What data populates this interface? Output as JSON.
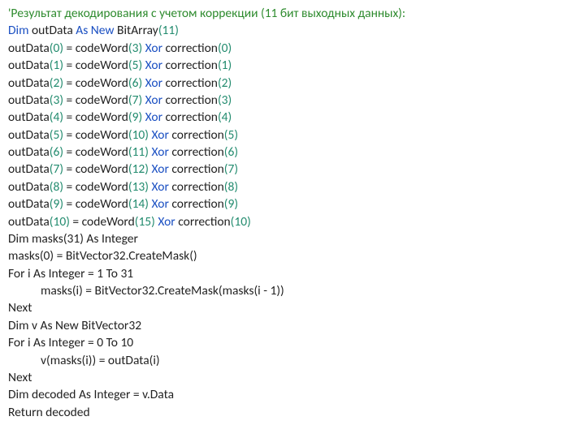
{
  "lines": [
    {
      "segs": [
        {
          "t": "'Результат декодирования с учетом коррекции (11 бит выходных данных):",
          "c": "cm"
        }
      ]
    },
    {
      "segs": [
        {
          "t": "Dim",
          "c": "kw"
        },
        {
          "t": " outData ",
          "c": "txt"
        },
        {
          "t": "As New",
          "c": "kw"
        },
        {
          "t": " BitArray",
          "c": "txt"
        },
        {
          "t": "(",
          "c": "pn"
        },
        {
          "t": "11",
          "c": "nm"
        },
        {
          "t": ")",
          "c": "pn"
        }
      ]
    },
    {
      "segs": [
        {
          "t": "outData",
          "c": "txt"
        },
        {
          "t": "(",
          "c": "pn"
        },
        {
          "t": "0",
          "c": "nm"
        },
        {
          "t": ")",
          "c": "pn"
        },
        {
          "t": " = codeWord",
          "c": "txt"
        },
        {
          "t": "(",
          "c": "pn"
        },
        {
          "t": "3",
          "c": "nm"
        },
        {
          "t": ")",
          "c": "pn"
        },
        {
          "t": " ",
          "c": "txt"
        },
        {
          "t": "Xor",
          "c": "kw"
        },
        {
          "t": " correction",
          "c": "txt"
        },
        {
          "t": "(",
          "c": "pn"
        },
        {
          "t": "0",
          "c": "nm"
        },
        {
          "t": ")",
          "c": "pn"
        }
      ]
    },
    {
      "segs": [
        {
          "t": "outData",
          "c": "txt"
        },
        {
          "t": "(",
          "c": "pn"
        },
        {
          "t": "1",
          "c": "nm"
        },
        {
          "t": ")",
          "c": "pn"
        },
        {
          "t": " = codeWord",
          "c": "txt"
        },
        {
          "t": "(",
          "c": "pn"
        },
        {
          "t": "5",
          "c": "nm"
        },
        {
          "t": ")",
          "c": "pn"
        },
        {
          "t": " ",
          "c": "txt"
        },
        {
          "t": "Xor",
          "c": "kw"
        },
        {
          "t": " correction",
          "c": "txt"
        },
        {
          "t": "(",
          "c": "pn"
        },
        {
          "t": "1",
          "c": "nm"
        },
        {
          "t": ")",
          "c": "pn"
        }
      ]
    },
    {
      "segs": [
        {
          "t": "outData",
          "c": "txt"
        },
        {
          "t": "(",
          "c": "pn"
        },
        {
          "t": "2",
          "c": "nm"
        },
        {
          "t": ")",
          "c": "pn"
        },
        {
          "t": " = codeWord",
          "c": "txt"
        },
        {
          "t": "(",
          "c": "pn"
        },
        {
          "t": "6",
          "c": "nm"
        },
        {
          "t": ")",
          "c": "pn"
        },
        {
          "t": " ",
          "c": "txt"
        },
        {
          "t": "Xor",
          "c": "kw"
        },
        {
          "t": " correction",
          "c": "txt"
        },
        {
          "t": "(",
          "c": "pn"
        },
        {
          "t": "2",
          "c": "nm"
        },
        {
          "t": ")",
          "c": "pn"
        }
      ]
    },
    {
      "segs": [
        {
          "t": "outData",
          "c": "txt"
        },
        {
          "t": "(",
          "c": "pn"
        },
        {
          "t": "3",
          "c": "nm"
        },
        {
          "t": ")",
          "c": "pn"
        },
        {
          "t": " = codeWord",
          "c": "txt"
        },
        {
          "t": "(",
          "c": "pn"
        },
        {
          "t": "7",
          "c": "nm"
        },
        {
          "t": ")",
          "c": "pn"
        },
        {
          "t": " ",
          "c": "txt"
        },
        {
          "t": "Xor",
          "c": "kw"
        },
        {
          "t": " correction",
          "c": "txt"
        },
        {
          "t": "(",
          "c": "pn"
        },
        {
          "t": "3",
          "c": "nm"
        },
        {
          "t": ")",
          "c": "pn"
        }
      ]
    },
    {
      "segs": [
        {
          "t": "outData",
          "c": "txt"
        },
        {
          "t": "(",
          "c": "pn"
        },
        {
          "t": "4",
          "c": "nm"
        },
        {
          "t": ")",
          "c": "pn"
        },
        {
          "t": " = codeWord",
          "c": "txt"
        },
        {
          "t": "(",
          "c": "pn"
        },
        {
          "t": "9",
          "c": "nm"
        },
        {
          "t": ")",
          "c": "pn"
        },
        {
          "t": " ",
          "c": "txt"
        },
        {
          "t": "Xor",
          "c": "kw"
        },
        {
          "t": " correction",
          "c": "txt"
        },
        {
          "t": "(",
          "c": "pn"
        },
        {
          "t": "4",
          "c": "nm"
        },
        {
          "t": ")",
          "c": "pn"
        }
      ]
    },
    {
      "segs": [
        {
          "t": "outData",
          "c": "txt"
        },
        {
          "t": "(",
          "c": "pn"
        },
        {
          "t": "5",
          "c": "nm"
        },
        {
          "t": ")",
          "c": "pn"
        },
        {
          "t": " = codeWord",
          "c": "txt"
        },
        {
          "t": "(",
          "c": "pn"
        },
        {
          "t": "10",
          "c": "nm"
        },
        {
          "t": ")",
          "c": "pn"
        },
        {
          "t": " ",
          "c": "txt"
        },
        {
          "t": "Xor",
          "c": "kw"
        },
        {
          "t": " correction",
          "c": "txt"
        },
        {
          "t": "(",
          "c": "pn"
        },
        {
          "t": "5",
          "c": "nm"
        },
        {
          "t": ")",
          "c": "pn"
        }
      ]
    },
    {
      "segs": [
        {
          "t": "outData",
          "c": "txt"
        },
        {
          "t": "(",
          "c": "pn"
        },
        {
          "t": "6",
          "c": "nm"
        },
        {
          "t": ")",
          "c": "pn"
        },
        {
          "t": " = codeWord",
          "c": "txt"
        },
        {
          "t": "(",
          "c": "pn"
        },
        {
          "t": "11",
          "c": "nm"
        },
        {
          "t": ")",
          "c": "pn"
        },
        {
          "t": " ",
          "c": "txt"
        },
        {
          "t": "Xor",
          "c": "kw"
        },
        {
          "t": " correction",
          "c": "txt"
        },
        {
          "t": "(",
          "c": "pn"
        },
        {
          "t": "6",
          "c": "nm"
        },
        {
          "t": ")",
          "c": "pn"
        }
      ]
    },
    {
      "segs": [
        {
          "t": "outData",
          "c": "txt"
        },
        {
          "t": "(",
          "c": "pn"
        },
        {
          "t": "7",
          "c": "nm"
        },
        {
          "t": ")",
          "c": "pn"
        },
        {
          "t": " = codeWord",
          "c": "txt"
        },
        {
          "t": "(",
          "c": "pn"
        },
        {
          "t": "12",
          "c": "nm"
        },
        {
          "t": ")",
          "c": "pn"
        },
        {
          "t": " ",
          "c": "txt"
        },
        {
          "t": "Xor",
          "c": "kw"
        },
        {
          "t": " correction",
          "c": "txt"
        },
        {
          "t": "(",
          "c": "pn"
        },
        {
          "t": "7",
          "c": "nm"
        },
        {
          "t": ")",
          "c": "pn"
        }
      ]
    },
    {
      "segs": [
        {
          "t": "outData",
          "c": "txt"
        },
        {
          "t": "(",
          "c": "pn"
        },
        {
          "t": "8",
          "c": "nm"
        },
        {
          "t": ")",
          "c": "pn"
        },
        {
          "t": " = codeWord",
          "c": "txt"
        },
        {
          "t": "(",
          "c": "pn"
        },
        {
          "t": "13",
          "c": "nm"
        },
        {
          "t": ")",
          "c": "pn"
        },
        {
          "t": " ",
          "c": "txt"
        },
        {
          "t": "Xor",
          "c": "kw"
        },
        {
          "t": " correction",
          "c": "txt"
        },
        {
          "t": "(",
          "c": "pn"
        },
        {
          "t": "8",
          "c": "nm"
        },
        {
          "t": ")",
          "c": "pn"
        }
      ]
    },
    {
      "segs": [
        {
          "t": "outData",
          "c": "txt"
        },
        {
          "t": "(",
          "c": "pn"
        },
        {
          "t": "9",
          "c": "nm"
        },
        {
          "t": ")",
          "c": "pn"
        },
        {
          "t": " = codeWord",
          "c": "txt"
        },
        {
          "t": "(",
          "c": "pn"
        },
        {
          "t": "14",
          "c": "nm"
        },
        {
          "t": ")",
          "c": "pn"
        },
        {
          "t": " ",
          "c": "txt"
        },
        {
          "t": "Xor",
          "c": "kw"
        },
        {
          "t": " correction",
          "c": "txt"
        },
        {
          "t": "(",
          "c": "pn"
        },
        {
          "t": "9",
          "c": "nm"
        },
        {
          "t": ")",
          "c": "pn"
        }
      ]
    },
    {
      "segs": [
        {
          "t": "outData",
          "c": "txt"
        },
        {
          "t": "(",
          "c": "pn"
        },
        {
          "t": "10",
          "c": "nm"
        },
        {
          "t": ")",
          "c": "pn"
        },
        {
          "t": " = codeWord",
          "c": "txt"
        },
        {
          "t": "(",
          "c": "pn"
        },
        {
          "t": "15",
          "c": "nm"
        },
        {
          "t": ")",
          "c": "pn"
        },
        {
          "t": " ",
          "c": "txt"
        },
        {
          "t": "Xor",
          "c": "kw"
        },
        {
          "t": " correction",
          "c": "txt"
        },
        {
          "t": "(",
          "c": "pn"
        },
        {
          "t": "10",
          "c": "nm"
        },
        {
          "t": ")",
          "c": "pn"
        }
      ]
    },
    {
      "segs": [
        {
          "t": "Dim masks(31) As Integer",
          "c": "txt"
        }
      ]
    },
    {
      "segs": [
        {
          "t": "masks(0) = BitVector32.CreateMask()",
          "c": "txt"
        }
      ]
    },
    {
      "segs": [
        {
          "t": "For i As Integer = 1 To 31",
          "c": "txt"
        }
      ]
    },
    {
      "indent": true,
      "segs": [
        {
          "t": "masks(i) = BitVector32.CreateMask(masks(i - 1))",
          "c": "txt"
        }
      ]
    },
    {
      "segs": [
        {
          "t": "Next",
          "c": "txt"
        }
      ]
    },
    {
      "segs": [
        {
          "t": "Dim v As New BitVector32",
          "c": "txt"
        }
      ]
    },
    {
      "segs": [
        {
          "t": "For i As Integer = 0 To 10",
          "c": "txt"
        }
      ]
    },
    {
      "indent": true,
      "segs": [
        {
          "t": "v(masks(i)) = outData(i)",
          "c": "txt"
        }
      ]
    },
    {
      "segs": [
        {
          "t": "Next",
          "c": "txt"
        }
      ]
    },
    {
      "segs": [
        {
          "t": "Dim decoded As Integer = v.Data",
          "c": "txt"
        }
      ]
    },
    {
      "segs": [
        {
          "t": "Return decoded",
          "c": "txt"
        }
      ]
    }
  ]
}
